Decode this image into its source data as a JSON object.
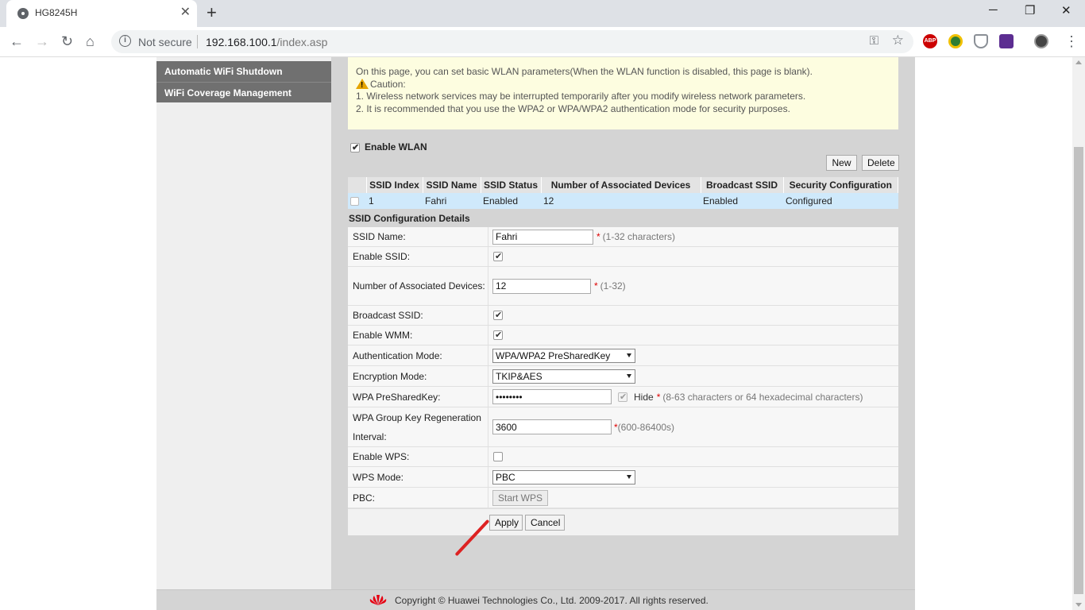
{
  "browser": {
    "tab_title": "HG8245H",
    "tab_close": "✕",
    "new_tab": "+",
    "not_secure": "Not secure",
    "url_host": "192.168.100.1",
    "url_path": "/index.asp",
    "ext_abp": "ABP",
    "win_min": "─",
    "win_max": "❐",
    "win_close": "✕"
  },
  "sidebar": {
    "items": [
      {
        "label": "Automatic WiFi Shutdown"
      },
      {
        "label": "WiFi Coverage Management"
      }
    ]
  },
  "notice": {
    "line1": "On this page, you can set basic WLAN parameters(When the WLAN function is disabled, this page is blank).",
    "caution": "Caution:",
    "line2": "1. Wireless network services may be interrupted temporarily after you modify wireless network parameters.",
    "line3": "2. It is recommended that you use the WPA2 or WPA/WPA2 authentication mode for security purposes."
  },
  "wlan": {
    "enable_label": "Enable WLAN",
    "enabled": true,
    "new_label": "New",
    "delete_label": "Delete"
  },
  "ssid_table": {
    "headers": [
      "SSID Index",
      "SSID Name",
      "SSID Status",
      "Number of Associated Devices",
      "Broadcast SSID",
      "Security Configuration"
    ],
    "rows": [
      {
        "index": "1",
        "name": "Fahri",
        "status": "Enabled",
        "devices": "12",
        "broadcast": "Enabled",
        "security": "Configured"
      }
    ]
  },
  "config": {
    "title": "SSID Configuration Details",
    "ssid_name_label": "SSID Name:",
    "ssid_name_value": "Fahri",
    "ssid_name_hint": "(1-32 characters)",
    "enable_ssid_label": "Enable SSID:",
    "assoc_label": "Number of Associated Devices:",
    "assoc_value": "12",
    "assoc_hint": "(1-32)",
    "broadcast_label": "Broadcast SSID:",
    "wmm_label": "Enable WMM:",
    "auth_label": "Authentication Mode:",
    "auth_value": "WPA/WPA2 PreSharedKey",
    "enc_label": "Encryption Mode:",
    "enc_value": "TKIP&AES",
    "psk_label": "WPA PreSharedKey:",
    "psk_value": "••••••••",
    "hide_label": "Hide",
    "psk_hint": "(8-63 characters or 64 hexadecimal characters)",
    "rekey_label": "WPA Group Key Regeneration Interval:",
    "rekey_value": "3600",
    "rekey_hint": "(600-86400s)",
    "wps_label": "Enable WPS:",
    "wps_mode_label": "WPS Mode:",
    "wps_mode_value": "PBC",
    "pbc_label": "PBC:",
    "start_wps_label": "Start WPS",
    "required_mark": "*",
    "apply_label": "Apply",
    "cancel_label": "Cancel"
  },
  "footer": {
    "copyright": "Copyright © Huawei Technologies Co., Ltd. 2009-2017. All rights reserved."
  },
  "colors": {
    "sidebar_item": "#707070",
    "selected_row": "#cfe9fb",
    "notice_bg": "#fdfde0",
    "annotation": "#dd2222"
  }
}
